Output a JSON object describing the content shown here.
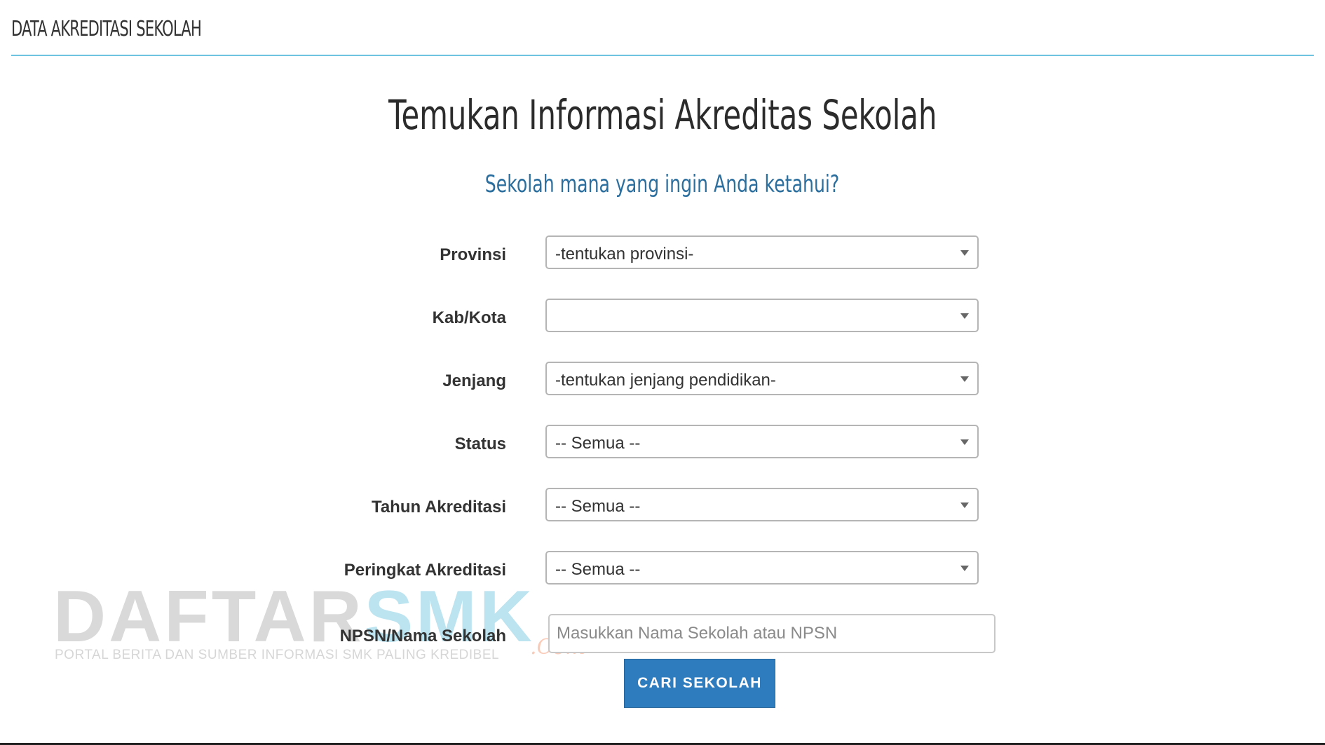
{
  "header": {
    "section_title": "DATA AKREDITASI SEKOLAH"
  },
  "main": {
    "heading": "Temukan Informasi Akreditas Sekolah",
    "subheading": "Sekolah mana yang ingin Anda ketahui?"
  },
  "form": {
    "provinsi": {
      "label": "Provinsi",
      "value": "-tentukan provinsi-"
    },
    "kabkota": {
      "label": "Kab/Kota",
      "value": ""
    },
    "jenjang": {
      "label": "Jenjang",
      "value": "-tentukan jenjang pendidikan-"
    },
    "status": {
      "label": "Status",
      "value": "-- Semua --"
    },
    "tahun": {
      "label": "Tahun Akreditasi",
      "value": "-- Semua --"
    },
    "peringkat": {
      "label": "Peringkat Akreditasi",
      "value": "-- Semua --"
    },
    "npsn": {
      "label": "NPSN/Nama Sekolah",
      "value": "",
      "placeholder": "Masukkan Nama Sekolah atau NPSN"
    },
    "submit_label": "CARI SEKOLAH"
  },
  "watermark": {
    "part_a": "DAFTAR",
    "part_b": "SMK",
    "suffix": ".Com",
    "tagline": "PORTAL BERITA DAN SUMBER INFORMASI SMK PALING KREDIBEL"
  },
  "colors": {
    "accent_line": "#6ec3e0",
    "subheading": "#2c6f9e",
    "button": "#2e7bbd"
  }
}
